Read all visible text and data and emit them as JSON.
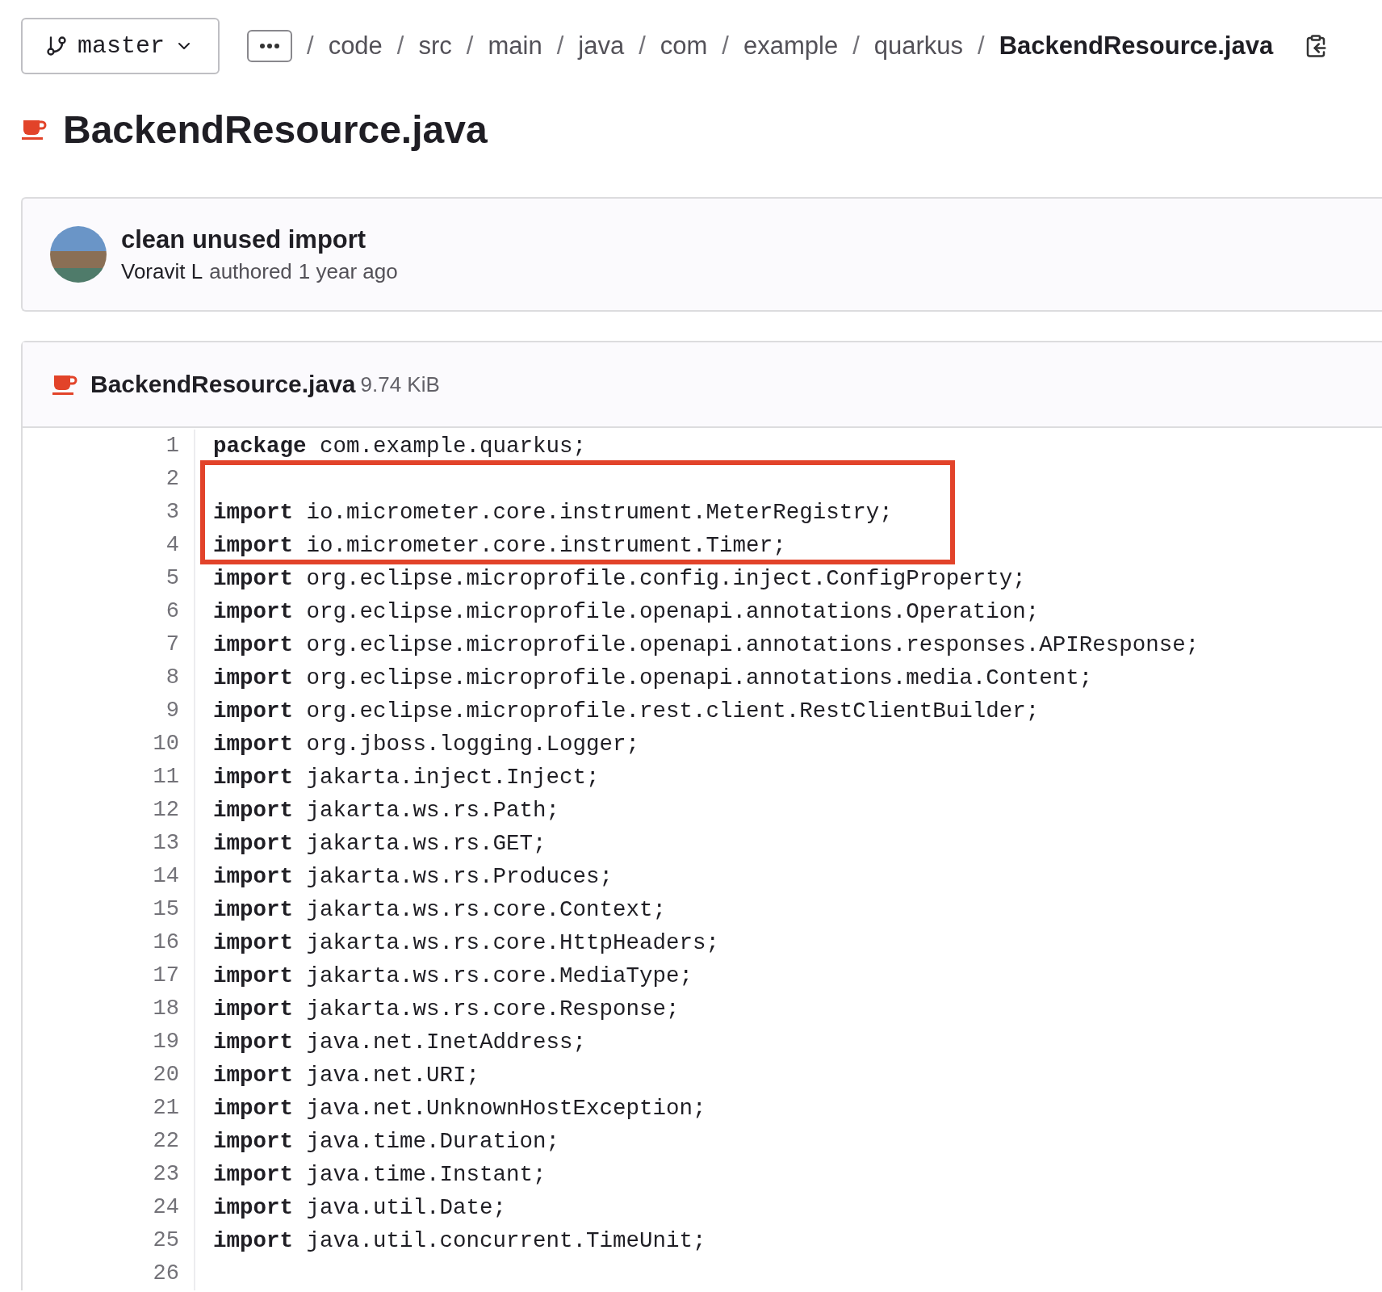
{
  "branch": {
    "name": "master"
  },
  "breadcrumb": {
    "separator": "/",
    "segments": [
      "code",
      "src",
      "main",
      "java",
      "com",
      "example",
      "quarkus"
    ],
    "current": "BackendResource.java"
  },
  "title": "BackendResource.java",
  "commit": {
    "message": "clean unused import",
    "author": "Voravit L",
    "action": "authored",
    "time": "1 year ago"
  },
  "file": {
    "name": "BackendResource.java",
    "size": "9.74 KiB",
    "lines": [
      {
        "number": "1",
        "keyword": "package",
        "rest": " com.example.quarkus;",
        "highlighted": false
      },
      {
        "number": "2",
        "highlighted": true
      },
      {
        "number": "3",
        "keyword": "import",
        "rest": " io.micrometer.core.instrument.MeterRegistry;",
        "highlighted": true
      },
      {
        "number": "4",
        "keyword": "import",
        "rest": " io.micrometer.core.instrument.Timer;",
        "highlighted": true
      },
      {
        "number": "5",
        "keyword": "import",
        "rest": " org.eclipse.microprofile.config.inject.ConfigProperty;",
        "highlighted": false
      },
      {
        "number": "6",
        "keyword": "import",
        "rest": " org.eclipse.microprofile.openapi.annotations.Operation;",
        "highlighted": false
      },
      {
        "number": "7",
        "keyword": "import",
        "rest": " org.eclipse.microprofile.openapi.annotations.responses.APIResponse;",
        "highlighted": false
      },
      {
        "number": "8",
        "keyword": "import",
        "rest": " org.eclipse.microprofile.openapi.annotations.media.Content;",
        "highlighted": false
      },
      {
        "number": "9",
        "keyword": "import",
        "rest": " org.eclipse.microprofile.rest.client.RestClientBuilder;",
        "highlighted": false
      },
      {
        "number": "10",
        "keyword": "import",
        "rest": " org.jboss.logging.Logger;",
        "highlighted": false
      },
      {
        "number": "11",
        "keyword": "import",
        "rest": " jakarta.inject.Inject;",
        "highlighted": false
      },
      {
        "number": "12",
        "keyword": "import",
        "rest": " jakarta.ws.rs.Path;",
        "highlighted": false
      },
      {
        "number": "13",
        "keyword": "import",
        "rest": " jakarta.ws.rs.GET;",
        "highlighted": false
      },
      {
        "number": "14",
        "keyword": "import",
        "rest": " jakarta.ws.rs.Produces;",
        "highlighted": false
      },
      {
        "number": "15",
        "keyword": "import",
        "rest": " jakarta.ws.rs.core.Context;",
        "highlighted": false
      },
      {
        "number": "16",
        "keyword": "import",
        "rest": " jakarta.ws.rs.core.HttpHeaders;",
        "highlighted": false
      },
      {
        "number": "17",
        "keyword": "import",
        "rest": " jakarta.ws.rs.core.MediaType;",
        "highlighted": false
      },
      {
        "number": "18",
        "keyword": "import",
        "rest": " jakarta.ws.rs.core.Response;",
        "highlighted": false
      },
      {
        "number": "19",
        "keyword": "import",
        "rest": " java.net.InetAddress;",
        "highlighted": false
      },
      {
        "number": "20",
        "keyword": "import",
        "rest": " java.net.URI;",
        "highlighted": false
      },
      {
        "number": "21",
        "keyword": "import",
        "rest": " java.net.UnknownHostException;",
        "highlighted": false
      },
      {
        "number": "22",
        "keyword": "import",
        "rest": " java.time.Duration;",
        "highlighted": false
      },
      {
        "number": "23",
        "keyword": "import",
        "rest": " java.time.Instant;",
        "highlighted": false
      },
      {
        "number": "24",
        "keyword": "import",
        "rest": " java.util.Date;",
        "highlighted": false
      },
      {
        "number": "25",
        "keyword": "import",
        "rest": " java.util.concurrent.TimeUnit;",
        "highlighted": false
      },
      {
        "number": "26",
        "highlighted": false
      }
    ]
  }
}
